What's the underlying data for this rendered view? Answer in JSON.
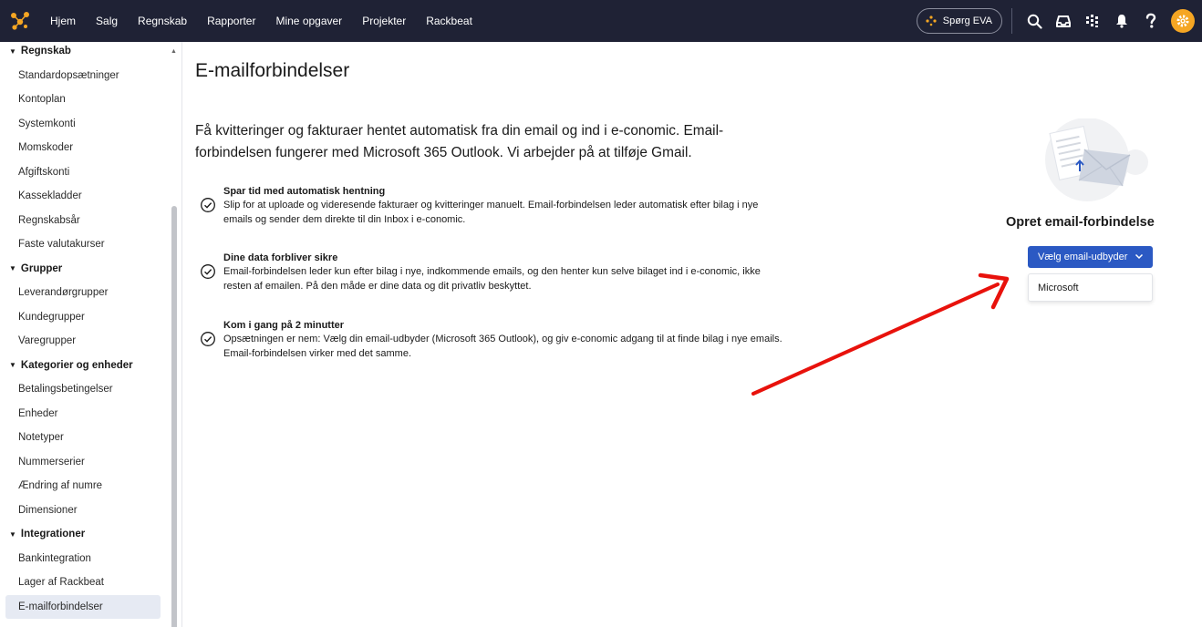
{
  "topbar": {
    "nav": [
      "Hjem",
      "Salg",
      "Regnskab",
      "Rapporter",
      "Mine opgaver",
      "Projekter",
      "Rackbeat"
    ],
    "eva_label": "Spørg EVA",
    "accent": "#f5a623"
  },
  "sidebar": {
    "items": [
      {
        "label": "Regnskab",
        "type": "group"
      },
      {
        "label": "Standardopsætninger",
        "type": "item"
      },
      {
        "label": "Kontoplan",
        "type": "item"
      },
      {
        "label": "Systemkonti",
        "type": "item"
      },
      {
        "label": "Momskoder",
        "type": "item"
      },
      {
        "label": "Afgiftskonti",
        "type": "item"
      },
      {
        "label": "Kassekladder",
        "type": "item"
      },
      {
        "label": "Regnskabsår",
        "type": "item"
      },
      {
        "label": "Faste valutakurser",
        "type": "item"
      },
      {
        "label": "Grupper",
        "type": "group"
      },
      {
        "label": "Leverandørgrupper",
        "type": "item"
      },
      {
        "label": "Kundegrupper",
        "type": "item"
      },
      {
        "label": "Varegrupper",
        "type": "item"
      },
      {
        "label": "Kategorier og enheder",
        "type": "group"
      },
      {
        "label": "Betalingsbetingelser",
        "type": "item"
      },
      {
        "label": "Enheder",
        "type": "item"
      },
      {
        "label": "Notetyper",
        "type": "item"
      },
      {
        "label": "Nummerserier",
        "type": "item"
      },
      {
        "label": "Ændring af numre",
        "type": "item"
      },
      {
        "label": "Dimensioner",
        "type": "item"
      },
      {
        "label": "Integrationer",
        "type": "group"
      },
      {
        "label": "Bankintegration",
        "type": "item"
      },
      {
        "label": "Lager af Rackbeat",
        "type": "item"
      },
      {
        "label": "E-mailforbindelser",
        "type": "item",
        "active": true
      }
    ]
  },
  "main": {
    "title": "E-mailforbindelser",
    "intro": "Få kvitteringer og fakturaer hentet automatisk fra din email og ind i e-conomic. Email-forbindelsen fungerer med Microsoft 365 Outlook. Vi arbejder på at tilføje Gmail.",
    "features": [
      {
        "title": "Spar tid med automatisk hentning",
        "text": "Slip for at uploade og videresende fakturaer og kvitteringer manuelt. Email-forbindelsen leder automatisk efter bilag i nye emails og sender dem direkte til din Inbox i e-conomic."
      },
      {
        "title": "Dine data forbliver sikre",
        "text": "Email-forbindelsen leder kun efter bilag i nye, indkommende emails, og den henter kun selve bilaget ind i e-conomic, ikke resten af emailen. På den måde er dine data og dit privatliv beskyttet."
      },
      {
        "title": "Kom i gang på 2 minutter",
        "text": "Opsætningen er nem: Vælg din email-udbyder (Microsoft 365 Outlook), og giv e-conomic adgang til at finde bilag i nye emails. Email-forbindelsen virker med det samme."
      }
    ]
  },
  "panel": {
    "title": "Opret email-forbindelse",
    "button_label": "Vælg email-udbyder",
    "button_color": "#2b59c3",
    "options": [
      "Microsoft"
    ]
  },
  "annotation": {
    "arrow_color": "#e8120c"
  }
}
